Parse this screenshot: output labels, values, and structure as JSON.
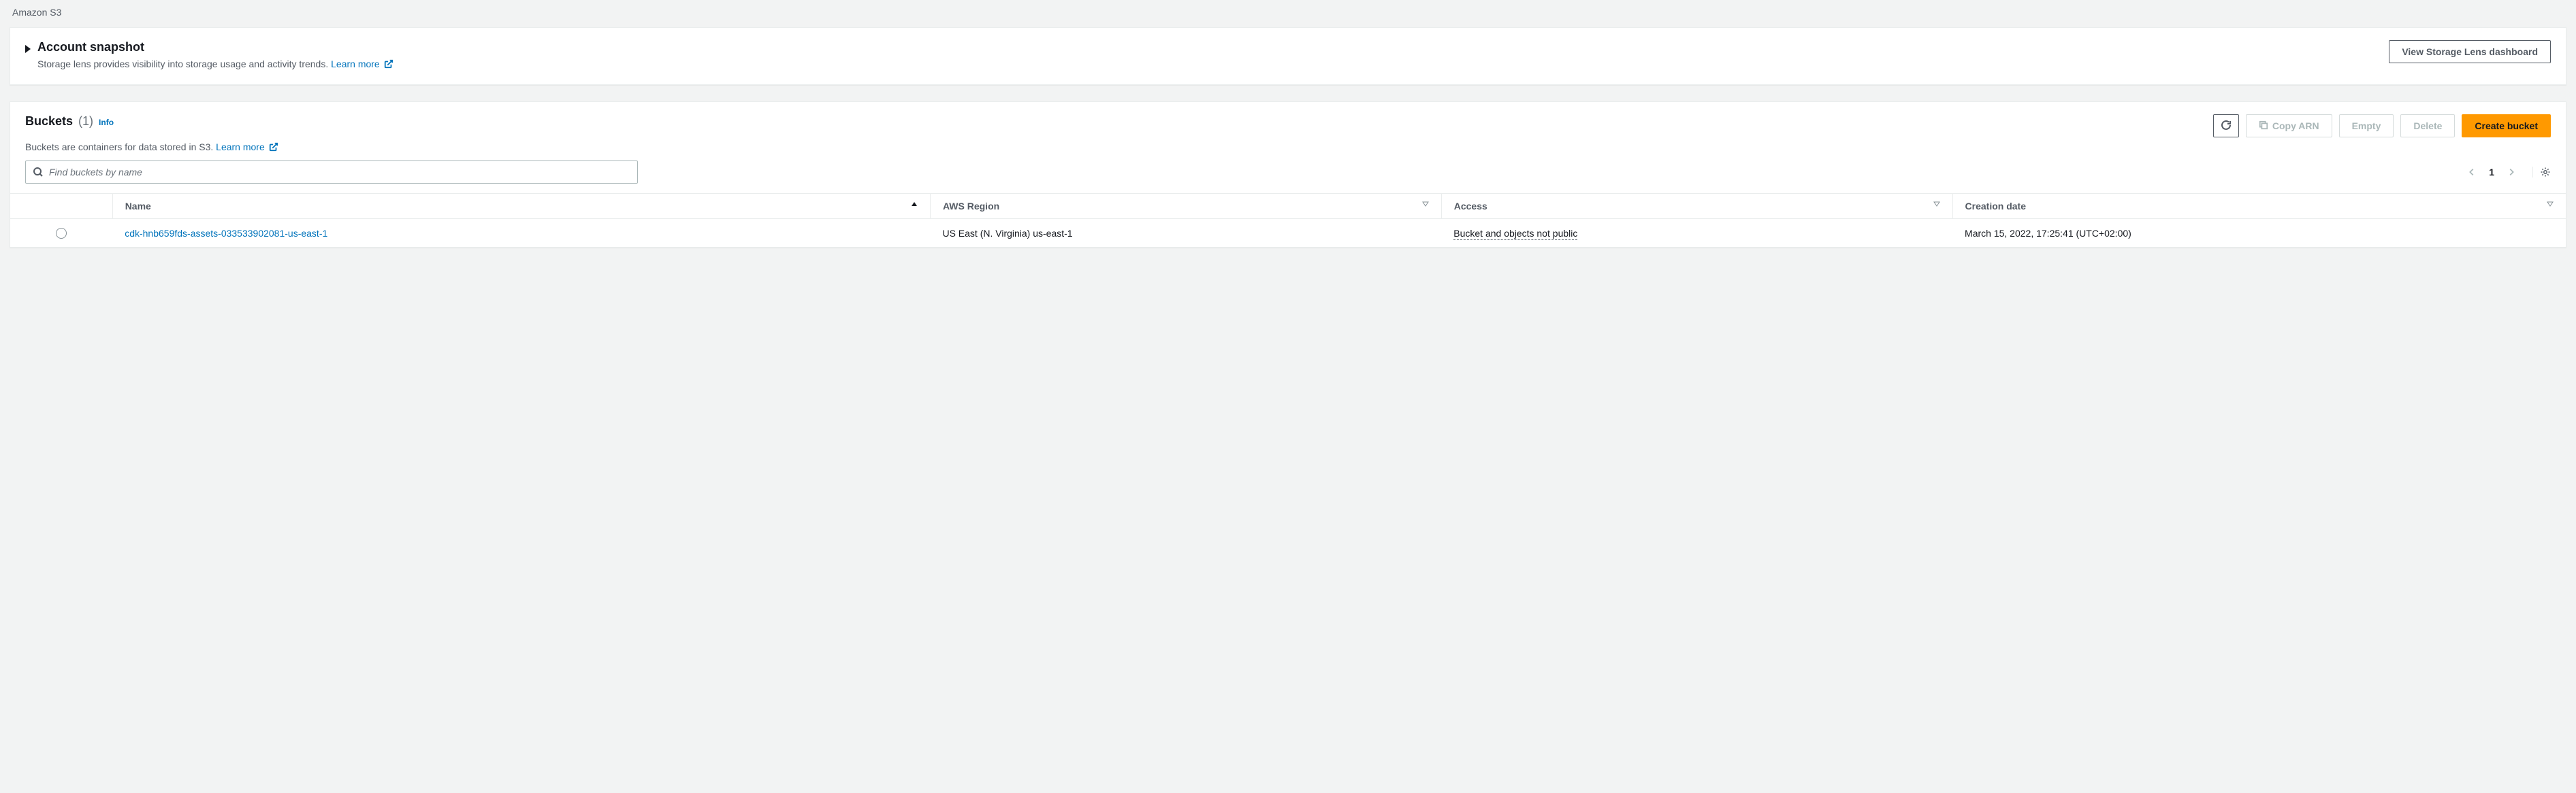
{
  "breadcrumb": "Amazon S3",
  "snapshot": {
    "title": "Account snapshot",
    "subtitle": "Storage lens provides visibility into storage usage and activity trends.",
    "learn_more": "Learn more",
    "button": "View Storage Lens dashboard"
  },
  "buckets": {
    "title": "Buckets",
    "count": "(1)",
    "info": "Info",
    "subtitle": "Buckets are containers for data stored in S3.",
    "learn_more": "Learn more",
    "actions": {
      "copy_arn": "Copy ARN",
      "empty": "Empty",
      "delete": "Delete",
      "create": "Create bucket"
    },
    "search": {
      "placeholder": "Find buckets by name"
    },
    "pager": {
      "page": "1"
    },
    "columns": {
      "name": "Name",
      "region": "AWS Region",
      "access": "Access",
      "date": "Creation date"
    },
    "rows": [
      {
        "name": "cdk-hnb659fds-assets-033533902081-us-east-1",
        "region": "US East (N. Virginia) us-east-1",
        "access": "Bucket and objects not public",
        "date": "March 15, 2022, 17:25:41 (UTC+02:00)"
      }
    ]
  }
}
